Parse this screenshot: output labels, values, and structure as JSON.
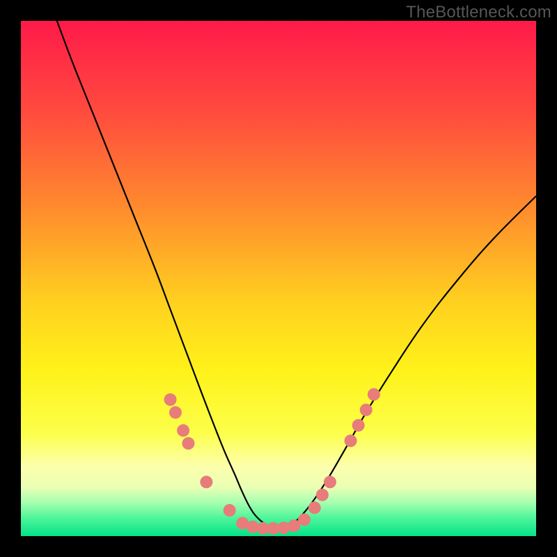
{
  "watermark": "TheBottleneck.com",
  "colors": {
    "frame": "#000000",
    "curve": "#000000",
    "dot_fill": "#e77c7a",
    "gradient_stops": [
      {
        "offset": 0.0,
        "color": "#ff1a49"
      },
      {
        "offset": 0.18,
        "color": "#ff4c3e"
      },
      {
        "offset": 0.36,
        "color": "#ff8a2e"
      },
      {
        "offset": 0.55,
        "color": "#ffd21f"
      },
      {
        "offset": 0.68,
        "color": "#fff21a"
      },
      {
        "offset": 0.8,
        "color": "#fcff4a"
      },
      {
        "offset": 0.865,
        "color": "#fdffad"
      },
      {
        "offset": 0.905,
        "color": "#eaffb4"
      },
      {
        "offset": 0.935,
        "color": "#a6ffb0"
      },
      {
        "offset": 0.965,
        "color": "#4df59a"
      },
      {
        "offset": 1.0,
        "color": "#05e387"
      }
    ]
  },
  "chart_data": {
    "type": "line",
    "title": "",
    "xlabel": "",
    "ylabel": "",
    "xlim": [
      0,
      100
    ],
    "ylim": [
      0,
      100
    ],
    "grid": false,
    "series": [
      {
        "name": "bottleneck-curve",
        "x": [
          7,
          10,
          14,
          18,
          22,
          26,
          29,
          32,
          35,
          37.5,
          39.5,
          41.5,
          43,
          44.5,
          46,
          48,
          50,
          52,
          54,
          56.5,
          59.5,
          63,
          67,
          72,
          78,
          85,
          92,
          100
        ],
        "y": [
          100,
          92,
          82,
          72,
          62,
          52,
          44,
          36,
          28,
          21.5,
          16.5,
          12,
          8.5,
          5.5,
          3.5,
          2.0,
          1.5,
          2.0,
          3.5,
          6.5,
          11,
          17,
          24,
          32,
          41,
          50,
          58,
          66
        ]
      }
    ],
    "dots": [
      {
        "x": 29.0,
        "y": 26.5
      },
      {
        "x": 30.0,
        "y": 24.0
      },
      {
        "x": 31.5,
        "y": 20.5
      },
      {
        "x": 32.5,
        "y": 18.0
      },
      {
        "x": 36.0,
        "y": 10.5
      },
      {
        "x": 40.5,
        "y": 5.0
      },
      {
        "x": 43.0,
        "y": 2.5
      },
      {
        "x": 45.0,
        "y": 1.8
      },
      {
        "x": 47.0,
        "y": 1.5
      },
      {
        "x": 49.0,
        "y": 1.5
      },
      {
        "x": 51.0,
        "y": 1.6
      },
      {
        "x": 53.0,
        "y": 2.0
      },
      {
        "x": 55.0,
        "y": 3.2
      },
      {
        "x": 57.0,
        "y": 5.5
      },
      {
        "x": 58.5,
        "y": 8.0
      },
      {
        "x": 60.0,
        "y": 10.5
      },
      {
        "x": 64.0,
        "y": 18.5
      },
      {
        "x": 65.5,
        "y": 21.5
      },
      {
        "x": 67.0,
        "y": 24.5
      },
      {
        "x": 68.5,
        "y": 27.5
      }
    ],
    "dot_radius_px": 9
  }
}
